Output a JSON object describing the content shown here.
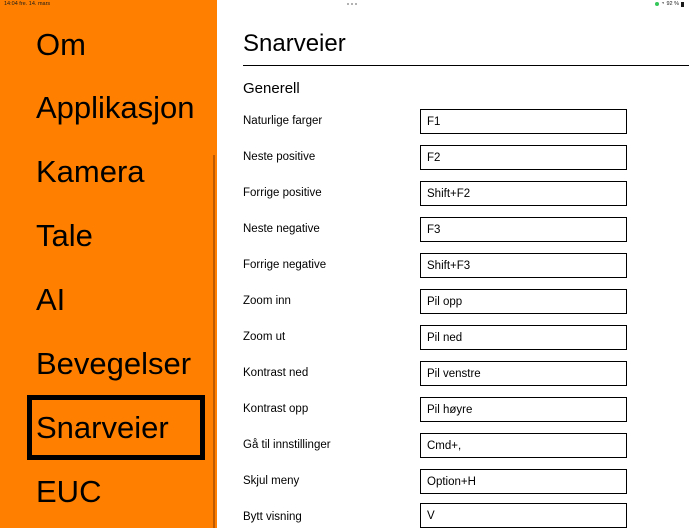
{
  "status_bar": {
    "time": "14:04",
    "date": "fre. 14. mars",
    "battery": "92 %"
  },
  "sidebar": {
    "items": [
      {
        "label": "Om"
      },
      {
        "label": "Applikasjon"
      },
      {
        "label": "Kamera"
      },
      {
        "label": "Tale"
      },
      {
        "label": "AI"
      },
      {
        "label": "Bevegelser"
      },
      {
        "label": "Snarveier",
        "selected": true
      },
      {
        "label": "EUC"
      }
    ],
    "background_color": "#ff8000"
  },
  "main": {
    "title": "Snarveier",
    "section": "Generell",
    "shortcuts": [
      {
        "label": "Naturlige farger",
        "value": "F1"
      },
      {
        "label": "Neste positive",
        "value": "F2"
      },
      {
        "label": "Forrige positive",
        "value": "Shift+F2"
      },
      {
        "label": "Neste negative",
        "value": "F3"
      },
      {
        "label": "Forrige negative",
        "value": "Shift+F3"
      },
      {
        "label": "Zoom inn",
        "value": "Pil opp"
      },
      {
        "label": "Zoom ut",
        "value": "Pil ned"
      },
      {
        "label": "Kontrast ned",
        "value": "Pil venstre"
      },
      {
        "label": "Kontrast opp",
        "value": "Pil høyre"
      },
      {
        "label": "Gå til innstillinger",
        "value": "Cmd+,"
      },
      {
        "label": "Skjul meny",
        "value": "Option+H"
      },
      {
        "label": "Bytt visning",
        "value": "V"
      }
    ]
  }
}
